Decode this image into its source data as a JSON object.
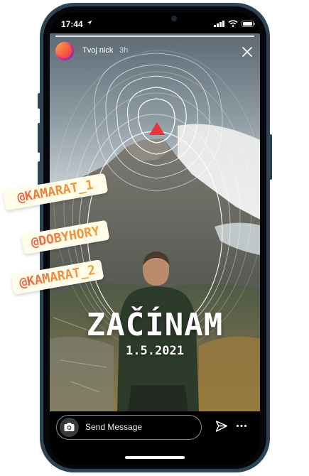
{
  "status_bar": {
    "time": "17:44"
  },
  "story": {
    "username": "Tvoj nick",
    "age": "3h",
    "headline": "ZAČÍNAM",
    "date": "1.5.2021"
  },
  "mentions": [
    "@KAMARAT_1",
    "@DOBYHORY",
    "@KAMARAT_2"
  ],
  "reply_bar": {
    "placeholder": "Send Message"
  },
  "colors": {
    "phone_frame": "#2d4455",
    "marker": "#e8363b",
    "mention_gradient_start": "#e8564a",
    "mention_gradient_end": "#f3a63c",
    "mention_background": "#fffde9"
  }
}
